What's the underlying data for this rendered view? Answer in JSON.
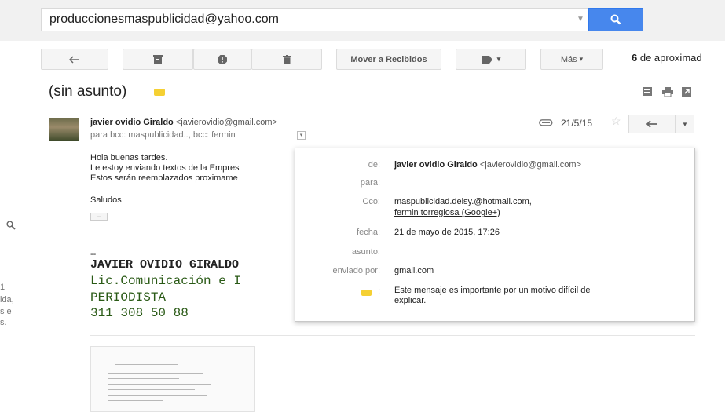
{
  "search": {
    "value": "produccionesmaspublicidad@yahoo.com"
  },
  "toolbar": {
    "move_to_inbox": "Mover a Recibidos",
    "more": "Más",
    "label_caret": "▾",
    "counter_bold": "6",
    "counter_rest": " de aproximad"
  },
  "thread": {
    "subject": "(sin asunto)"
  },
  "message": {
    "sender_name": "javier ovidio Giraldo",
    "sender_email": "<javierovidio@gmail.com>",
    "recipients": "para bcc: maspublicidad.., bcc: fermin",
    "date": "21/5/15",
    "body": [
      "Hola buenas tardes.",
      "Le estoy enviando textos de la Empres",
      "Estos serán reemplazados proximame",
      "Saludos"
    ],
    "ellipsis": "···",
    "signature": {
      "dash": "--",
      "name": "JAVIER OVIDIO GIRALDO",
      "line2": "Lic.Comunicación e I",
      "line3": "PERIODISTA",
      "line4": "311 308 50 88"
    }
  },
  "details_popup": {
    "from_label": "de:",
    "from_name": "javier ovidio Giraldo",
    "from_email": "<javierovidio@gmail.com>",
    "to_label": "para:",
    "bcc_label": "Cco:",
    "bcc_value_1": "maspublicidad.deisy.@hotmail.com,",
    "bcc_value_2": "fermin torreglosa (Google+)",
    "date_label": "fecha:",
    "date_value": "21 de mayo de 2015, 17:26",
    "subject_label": "asunto:",
    "sent_by_label": "enviado por:",
    "sent_by_value": "gmail.com",
    "importance_text_1": "Este mensaje es importante por un motivo difícil de",
    "importance_text_2": "explicar."
  },
  "left_fragments": [
    "1",
    "ida,",
    "s e",
    "s."
  ],
  "colors": {
    "accent_blue": "#4787ed",
    "label_yellow": "#f5d033",
    "signature_green": "#2a5a16"
  }
}
